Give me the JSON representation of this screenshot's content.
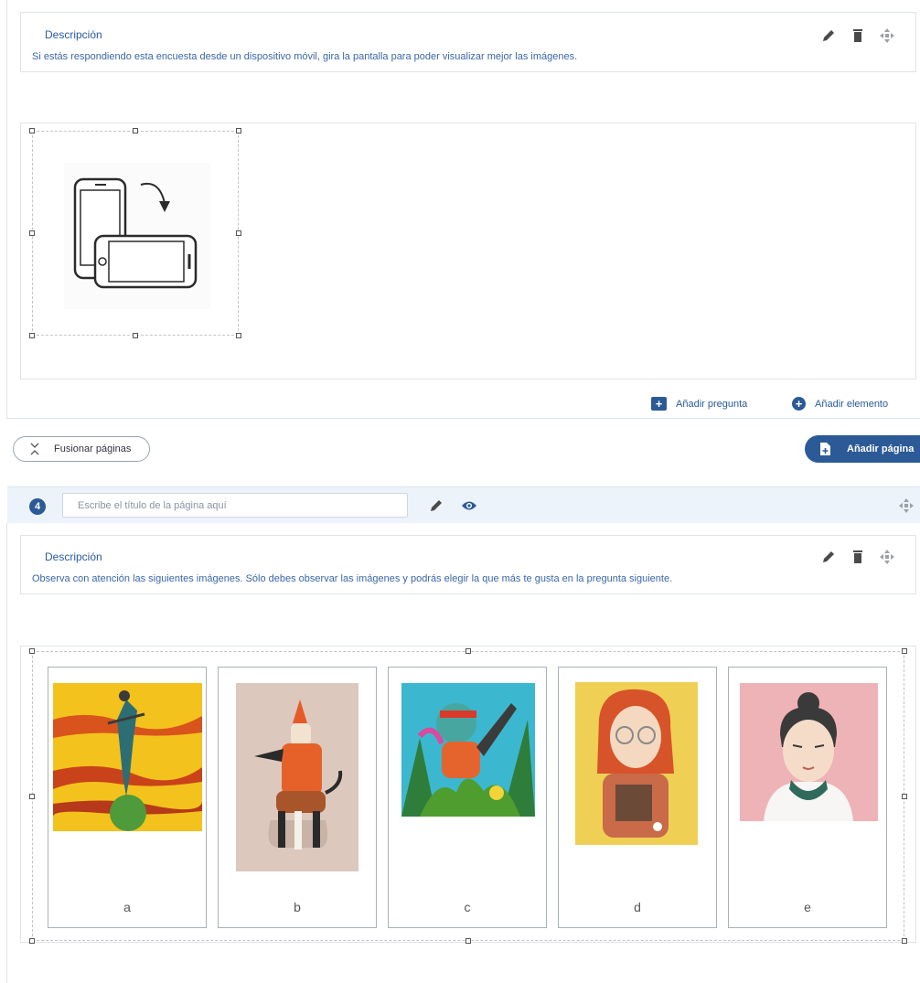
{
  "section1": {
    "description": {
      "title": "Descripción",
      "text": "Si estás respondiendo esta encuesta desde un dispositivo móvil, gira la pantalla para poder visualizar mejor las imágenes."
    },
    "image_icon": "rotate-phone-icon"
  },
  "add_bar": {
    "add_question": "Añadir pregunta",
    "add_element": "Añadir elemento"
  },
  "actions": {
    "merge_pages": "Fusionar páginas",
    "add_page": "Añadir página"
  },
  "page4": {
    "number": "4",
    "title_placeholder": "Escribe el título de la página aquí",
    "description": {
      "title": "Descripción",
      "text": "Observa con atención las siguientes imágenes. Sólo debes observar las imágenes y podrás elegir la que más te gusta en la pregunta siguiente."
    },
    "images": [
      {
        "label": "a"
      },
      {
        "label": "b"
      },
      {
        "label": "c"
      },
      {
        "label": "d"
      },
      {
        "label": "e"
      }
    ]
  },
  "colors": {
    "accent": "#2c5a96",
    "link": "#3a66a8",
    "header_bg": "#edf3fa"
  }
}
